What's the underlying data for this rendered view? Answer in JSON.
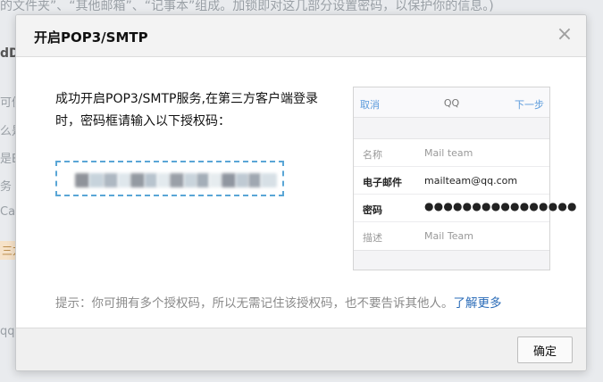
{
  "background": {
    "top_text": "的文件夹”、“其他邮箱”、“记事本”组成。加锁即对这几部分设置密码，以保护你的信息。)",
    "left_fragments": [
      "dD",
      "可傻",
      "么是",
      "是Ei",
      "务（",
      "Ca",
      "三方",
      "qq邮"
    ]
  },
  "dialog": {
    "title": "开启POP3/SMTP",
    "close_glyph": "×",
    "intro": "成功开启POP3/SMTP服务,在第三方客户端登录时，密码框请输入以下授权码：",
    "phone": {
      "nav_cancel": "取消",
      "nav_title": "QQ",
      "nav_next": "下一步",
      "rows": [
        {
          "label": "名称",
          "value": "Mail team",
          "strong": false
        },
        {
          "label": "电子邮件",
          "value": "mailteam@qq.com",
          "strong": true
        },
        {
          "label": "密码",
          "value": "●●●●●●●●●●●●●●●●",
          "strong": true
        },
        {
          "label": "描述",
          "value": "Mail Team",
          "strong": false
        }
      ]
    },
    "tip": "提示：你可拥有多个授权码，所以无需记住该授权码，也不要告诉其他人。",
    "learn_more": "了解更多",
    "ok_label": "确定"
  },
  "colors": {
    "accent_link": "#2b6cb8",
    "code_border": "#5aa6d6",
    "phone_link": "#5b9bdc"
  }
}
